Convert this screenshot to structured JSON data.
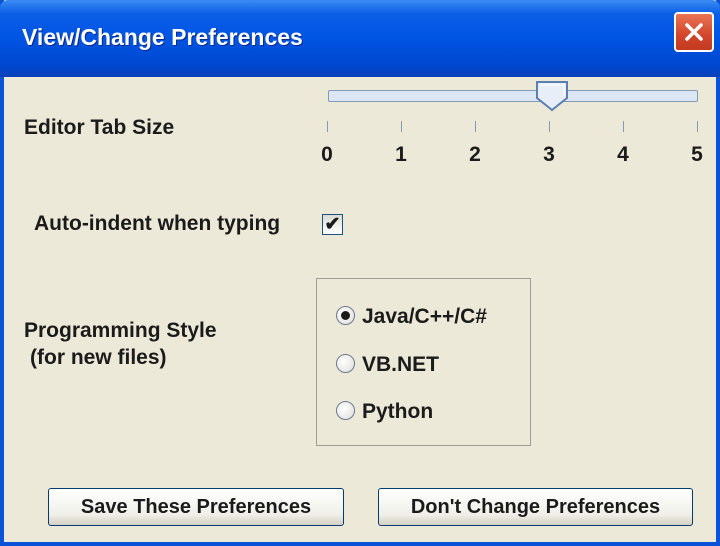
{
  "window": {
    "title": "View/Change Preferences"
  },
  "tab_size": {
    "label": "Editor Tab Size",
    "value": 3,
    "min": 0,
    "max": 5,
    "ticks": [
      "0",
      "1",
      "2",
      "3",
      "4",
      "5"
    ]
  },
  "auto_indent": {
    "label": "Auto-indent when typing",
    "checked": true,
    "mark": "✔"
  },
  "programming_style": {
    "label_line1": "Programming Style",
    "label_line2": "(for new files)",
    "selected": "Java/C++/C#",
    "options": [
      "Java/C++/C#",
      "VB.NET",
      "Python"
    ]
  },
  "buttons": {
    "save": "Save These Preferences",
    "cancel": "Don't Change Preferences"
  },
  "colors": {
    "title_bar": "#0054e3",
    "close_button": "#d2452a",
    "dialog_bg": "#ece9d8"
  },
  "icons": {
    "close": "close-icon",
    "slider_thumb": "slider-thumb"
  }
}
